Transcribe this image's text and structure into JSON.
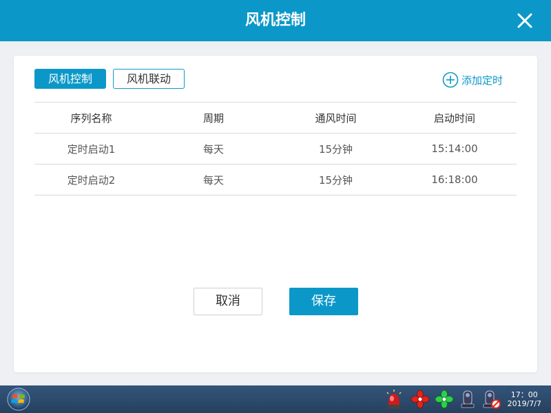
{
  "window": {
    "title": "风机控制",
    "close_icon": "close-icon"
  },
  "tabs": [
    {
      "label": "风机控制",
      "active": true
    },
    {
      "label": "风机联动",
      "active": false
    }
  ],
  "add_timer": {
    "label": "添加定时",
    "icon": "plus-circle-icon"
  },
  "table": {
    "columns": [
      "序列名称",
      "周期",
      "通风时间",
      "启动时间"
    ],
    "rows": [
      [
        "定时启动1",
        "每天",
        "15分钟",
        "15:14:00"
      ],
      [
        "定时启动2",
        "每天",
        "15分钟",
        "16:18:00"
      ]
    ]
  },
  "actions": {
    "cancel_label": "取消",
    "save_label": "保存"
  },
  "taskbar": {
    "start_icon": "windows-start-icon",
    "tray_icons": [
      "alarm-siren-icon",
      "fan-red-icon",
      "fan-green-icon",
      "camera-device-icon",
      "camera-device-disabled-icon"
    ],
    "clock_time": "17：00",
    "clock_date": "2019/7/7"
  },
  "colors": {
    "accent": "#0b98c9",
    "taskbar": "#2d4a6b",
    "background": "#eef0f3"
  }
}
